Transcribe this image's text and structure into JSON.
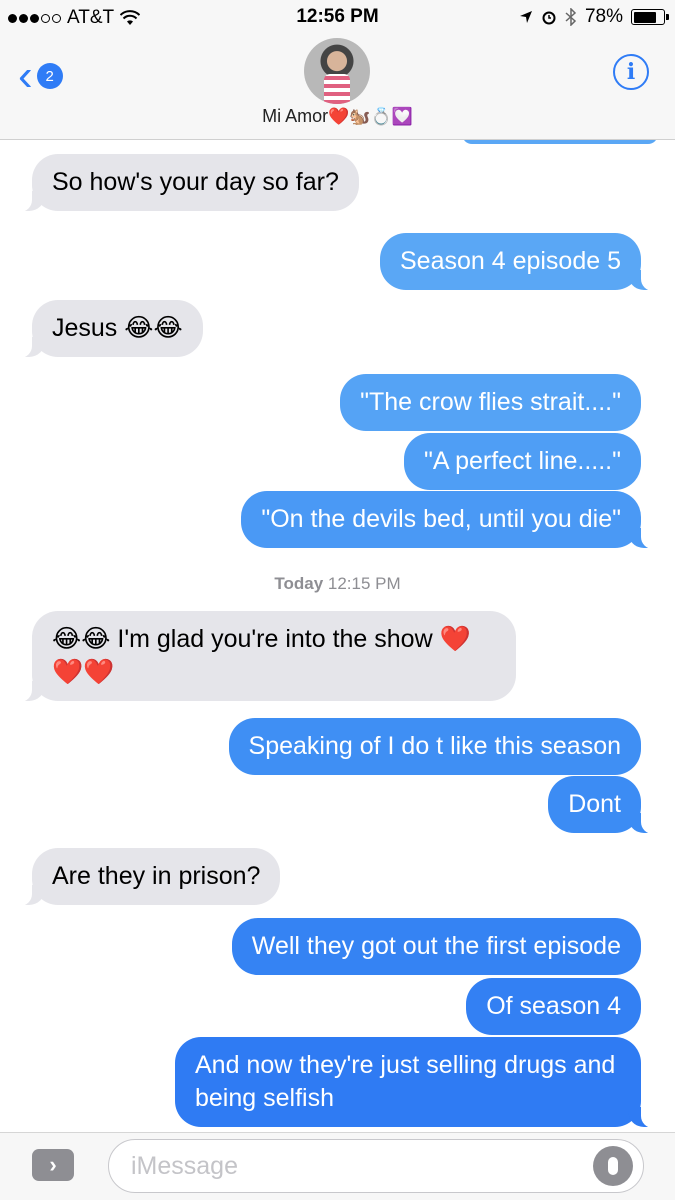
{
  "status_bar": {
    "carrier": "AT&T",
    "time": "12:56 PM",
    "battery_percent": "78%",
    "battery_level": 0.78,
    "icons": [
      "signal-dots-icon",
      "wifi-icon",
      "location-arrow-icon",
      "alarm-icon",
      "bluetooth-icon",
      "battery-icon"
    ]
  },
  "header": {
    "back_badge_count": "2",
    "contact_name": "Mi Amor",
    "contact_name_emoji": "❤️🐿️💍💟",
    "info_icon": "i"
  },
  "messages": [
    {
      "direction": "incoming",
      "text": "So how's your day so far?"
    },
    {
      "direction": "outgoing",
      "text": "Season 4 episode 5",
      "color": "#5aa7f5"
    },
    {
      "direction": "incoming",
      "text": "Jesus 😂😂"
    },
    {
      "direction": "outgoing",
      "text": "\"The crow flies strait....\"",
      "color": "#55a3f5"
    },
    {
      "direction": "outgoing",
      "text": "\"A perfect line.....\"",
      "color": "#4f9ef5"
    },
    {
      "direction": "outgoing",
      "text": "\"On the devils bed, until you die\"",
      "color": "#4a99f5"
    },
    {
      "direction": "incoming",
      "text": "😂😂 I'm glad you're into the show ❤️❤️❤️"
    },
    {
      "direction": "outgoing",
      "text": "Speaking of I do t like this season",
      "color": "#3f8ff4"
    },
    {
      "direction": "outgoing",
      "text": "Dont",
      "color": "#3c8cf4"
    },
    {
      "direction": "incoming",
      "text": "Are they in prison?"
    },
    {
      "direction": "outgoing",
      "text": "Well they got out the first episode",
      "color": "#3583f3"
    },
    {
      "direction": "outgoing",
      "text": "Of season 4",
      "color": "#3380f3"
    },
    {
      "direction": "outgoing",
      "text": "And now they're just selling drugs and being selfish",
      "color": "#2f7bf3"
    }
  ],
  "timestamp": {
    "day": "Today",
    "time": "12:15 PM"
  },
  "input_bar": {
    "placeholder": "iMessage",
    "expand_icon": "chevron-right-icon",
    "mic_icon": "microphone-icon"
  }
}
